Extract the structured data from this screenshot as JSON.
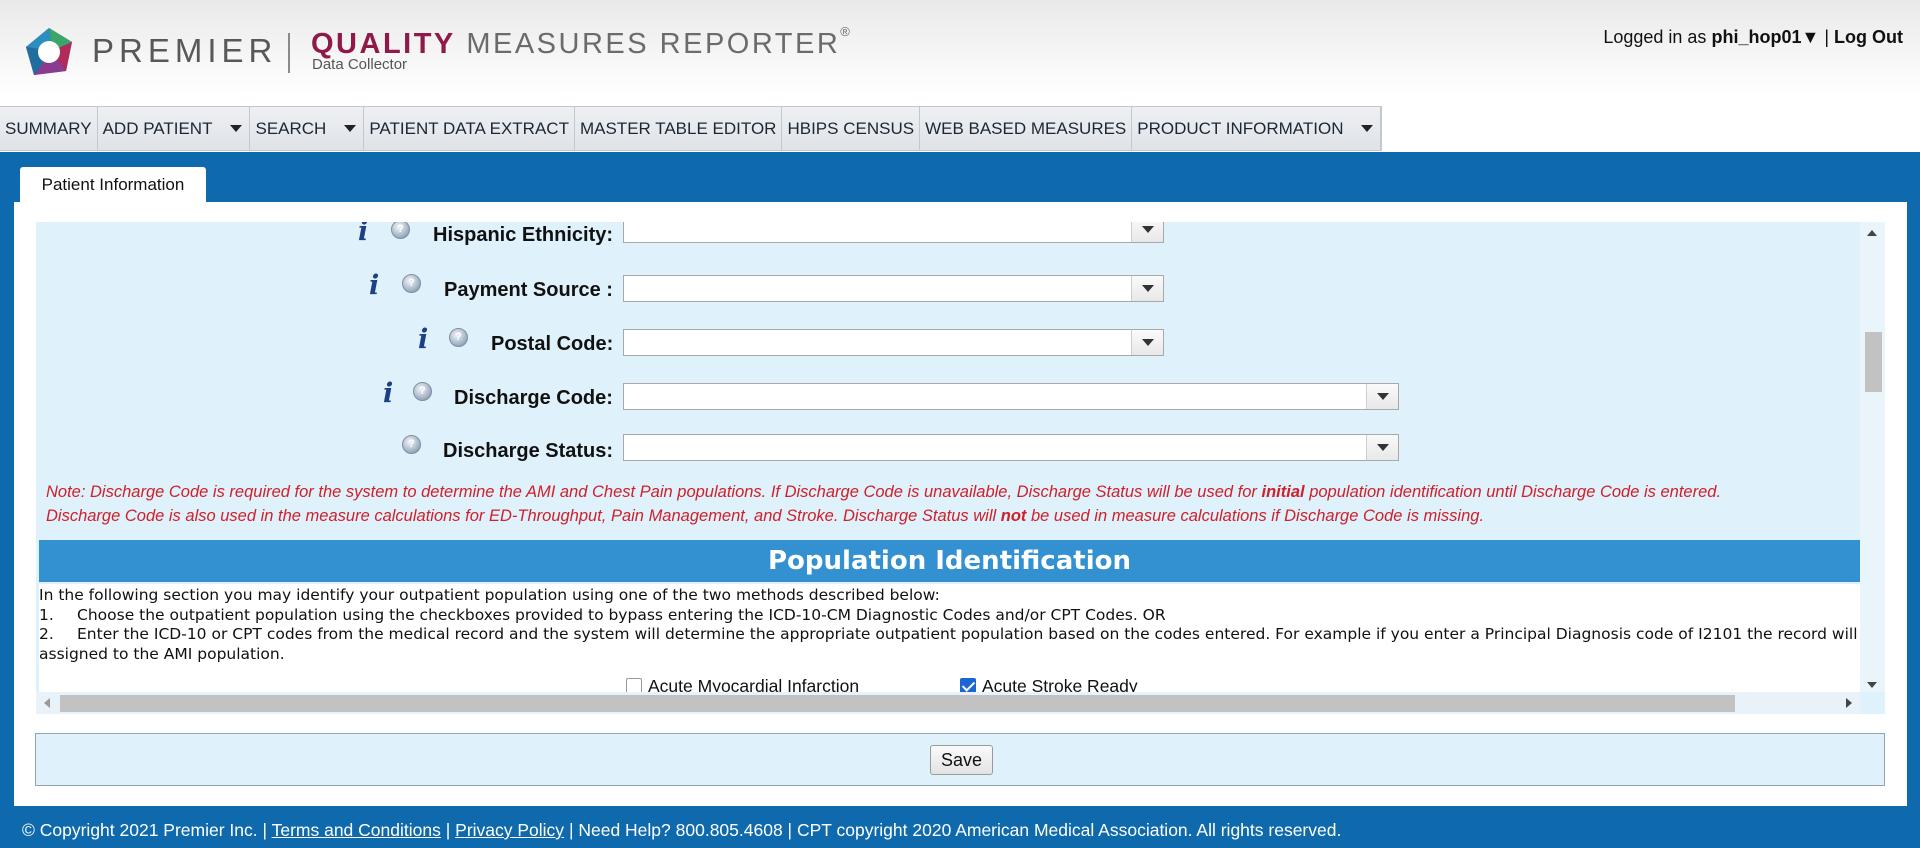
{
  "header": {
    "brand": "PREMIER",
    "product_bold": "QUALITY",
    "product_rest": "MEASURES REPORTER",
    "registered": "®",
    "subtitle": "Data Collector",
    "logged_in_prefix": "Logged in as",
    "username": "phi_hop01",
    "user_caret": "▼",
    "separator": "|",
    "logout_label": "Log Out"
  },
  "nav": {
    "items": [
      {
        "label": "SUMMARY"
      },
      {
        "label": "ADD PATIENT"
      },
      {
        "label": "SEARCH"
      },
      {
        "label": "PATIENT DATA EXTRACT"
      },
      {
        "label": "MASTER TABLE EDITOR"
      },
      {
        "label": "HBIPS CENSUS"
      },
      {
        "label": "WEB BASED MEASURES"
      },
      {
        "label": "PRODUCT INFORMATION"
      }
    ]
  },
  "tab": {
    "label": "Patient Information"
  },
  "form": {
    "info_glyph": "i",
    "help_glyph": "?",
    "fields": [
      {
        "label": "Hispanic Ethnicity:",
        "value": ""
      },
      {
        "label": "Payment Source :",
        "value": ""
      },
      {
        "label": "Postal Code:",
        "value": ""
      },
      {
        "label": "Discharge Code:",
        "value": ""
      },
      {
        "label": "Discharge Status:",
        "value": ""
      }
    ]
  },
  "note": {
    "line1_a": "Note: Discharge Code is required for the system to determine the AMI and Chest Pain populations. If Discharge Code is unavailable, Discharge Status will be used for ",
    "line1_b": "initial",
    "line1_c": " population identification until Discharge Code is entered.",
    "line2_a": "Discharge Code is also used in the measure calculations for ED-Throughput, Pain Management, and Stroke. Discharge Status will ",
    "line2_b": "not",
    "line2_c": " be used in measure calculations if Discharge Code is missing."
  },
  "population": {
    "title": "Population Identification",
    "intro": "In the following section you may identify your outpatient population using one of the two methods described below:",
    "item1_num": "1.",
    "item1": "Choose the outpatient population using the checkboxes provided to bypass entering the ICD-10-CM Diagnostic Codes and/or CPT Codes.     OR",
    "item2_num": "2.",
    "item2": "Enter the ICD-10 or CPT codes from the medical record and the system will determine the appropriate outpatient population based on the codes entered. For example if you enter a Principal Diagnosis code of I2101 the record will be",
    "item2_cont": "assigned to the AMI population.",
    "checkboxes": [
      {
        "label": "Acute Myocardial Infarction",
        "checked": false
      },
      {
        "label": "Acute Stroke Ready",
        "checked": true
      }
    ]
  },
  "save_label": "Save",
  "footer": {
    "copyright": "© Copyright 2021 Premier Inc.  |",
    "terms": "Terms and Conditions",
    "sep1": "|",
    "privacy": "Privacy Policy",
    "rest": "| Need Help? 800.805.4608 | CPT copyright 2020 American Medical Association. All rights reserved."
  },
  "colors": {
    "accent_blue": "#0f6aad",
    "section_blue": "#3391d2",
    "brand_maroon": "#8f1a4a",
    "note_red": "#d0202a",
    "form_bg": "#dff1fb"
  }
}
